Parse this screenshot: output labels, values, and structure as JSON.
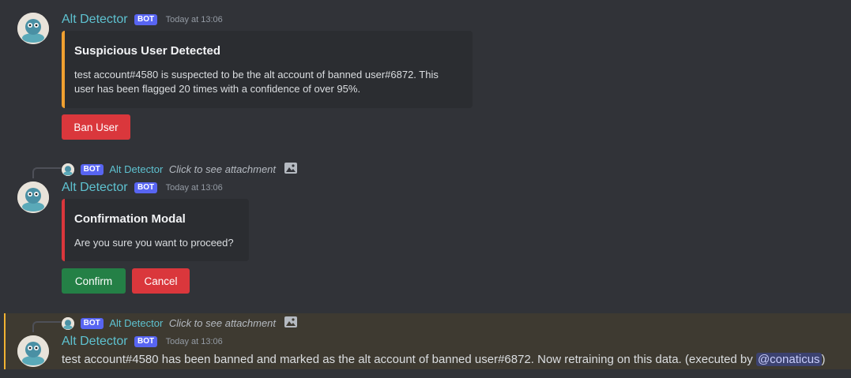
{
  "messages": [
    {
      "username": "Alt Detector",
      "bot_tag": "BOT",
      "timestamp": "Today at 13:06",
      "embed": {
        "title": "Suspicious User Detected",
        "description_line1": "test account#4580 is suspected to be the alt account of banned user#6872. This",
        "description_line2": "user has been flagged 20 times with a confidence of over 95%.",
        "accent_color": "#f0a030"
      },
      "buttons": [
        {
          "label": "Ban User",
          "style": "danger"
        }
      ]
    },
    {
      "reply": {
        "bot_tag": "BOT",
        "username": "Alt Detector",
        "text": "Click to see attachment",
        "icon": "image-icon"
      },
      "username": "Alt Detector",
      "bot_tag": "BOT",
      "timestamp": "Today at 13:06",
      "embed": {
        "title": "Confirmation Modal",
        "description": "Are you sure you want to proceed?",
        "accent_color": "#da373c"
      },
      "buttons": [
        {
          "label": "Confirm",
          "style": "success"
        },
        {
          "label": "Cancel",
          "style": "danger"
        }
      ]
    },
    {
      "reply": {
        "bot_tag": "BOT",
        "username": "Alt Detector",
        "text": "Click to see attachment",
        "icon": "image-icon"
      },
      "username": "Alt Detector",
      "bot_tag": "BOT",
      "timestamp": "Today at 13:06",
      "content": "test account#4580 has been banned and marked as the alt account of banned user#6872. Now retraining on this data. (executed by ",
      "mention": "@conaticus",
      "content_end": ")",
      "highlighted": true
    }
  ],
  "colors": {
    "background": "#313338",
    "username": "#5ec2d0",
    "bot_tag": "#5865f2",
    "highlight": "#f0b232"
  }
}
